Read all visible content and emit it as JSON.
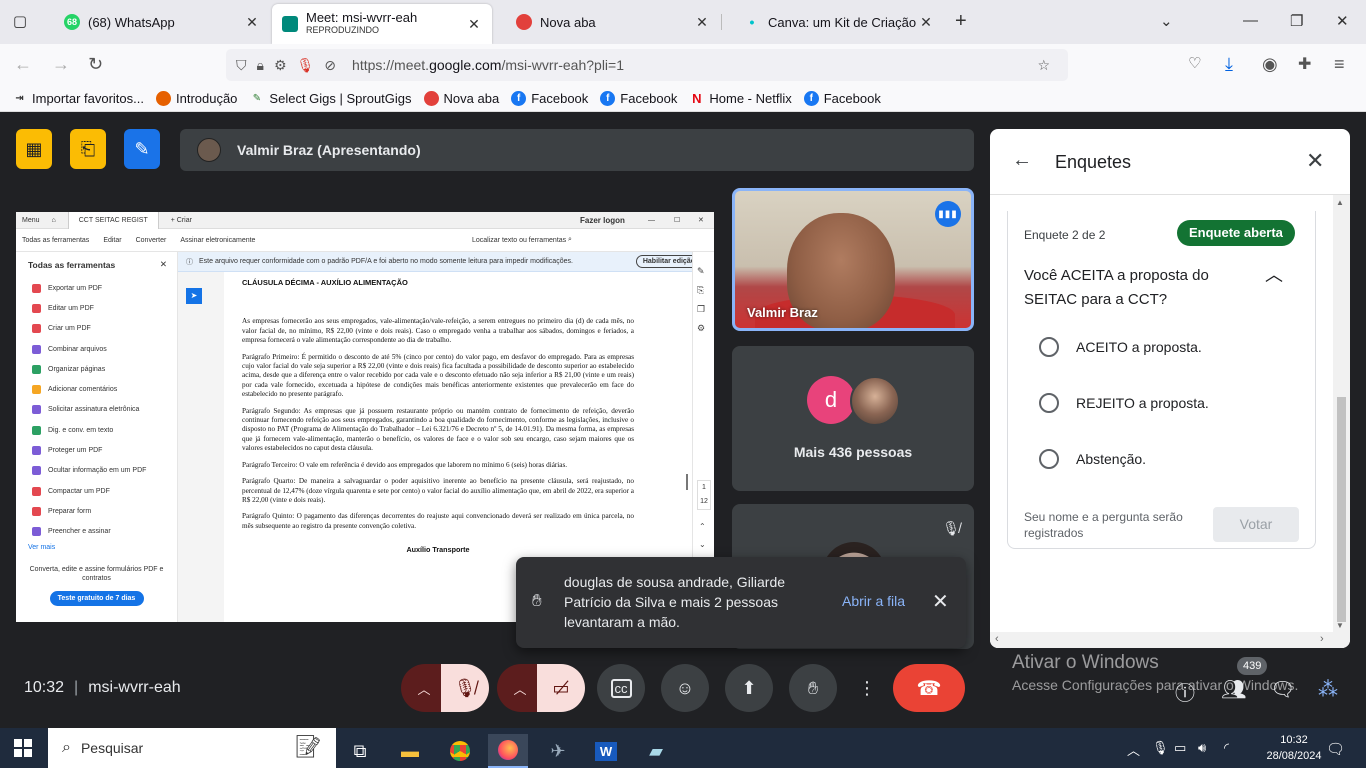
{
  "tabs": [
    {
      "title": "(68) WhatsApp",
      "badge": "68"
    },
    {
      "title": "Meet: msi-wvrr-eah",
      "subtitle": "REPRODUZINDO"
    },
    {
      "title": "Nova aba"
    },
    {
      "title": "Canva: um Kit de Criação Visual"
    }
  ],
  "url": {
    "prefix": "https://meet.",
    "domain": "google.com",
    "path": "/msi-wvrr-eah?pli=1"
  },
  "bookmarks": [
    "Importar favoritos...",
    "Introdução",
    "Select Gigs | SproutGigs",
    "Nova aba",
    "Facebook",
    "Facebook",
    "Home - Netflix",
    "Facebook"
  ],
  "presenter": {
    "label": "Valmir Braz (Apresentando)"
  },
  "share": {
    "top_menu": "Menu",
    "tab_title": "CCT SEITAC REGIST",
    "new_tab": "+ Criar",
    "login": "Fazer logon",
    "toolbar": [
      "Todas as ferramentas",
      "Editar",
      "Converter",
      "Assinar eletronicamente"
    ],
    "search_label": "Localizar texto ou ferramentas",
    "sidebar_title": "Todas as ferramentas",
    "sidebar_items": [
      "Exportar um PDF",
      "Editar um PDF",
      "Criar um PDF",
      "Combinar arquivos",
      "Organizar páginas",
      "Adicionar comentários",
      "Solicitar assinatura eletrônica",
      "Dig. e conv. em texto",
      "Proteger um PDF",
      "Ocultar informação em um PDF",
      "Compactar um PDF",
      "Preparar form",
      "Preencher e assinar"
    ],
    "see_more": "Ver mais",
    "note": "Converta, edite e assine formulários PDF e contratos",
    "trial": "Teste gratuito de 7 dias",
    "banner": "Este arquivo requer conformidade com o padrão PDF/A e foi aberto no modo somente leitura para impedir modificações.",
    "enable_edit": "Habilitar edição",
    "page_number": "1",
    "page_total": "12",
    "doc": {
      "heading": "CLÁUSULA DÉCIMA - AUXÍLIO ALIMENTAÇÃO",
      "p1": "As empresas fornecerão aos seus empregados, vale-alimentação/vale-refeição, a serem entregues no primeiro dia (d) de cada mês, no valor facial de, no mínimo, R$ 22,00 (vinte e dois reais). Caso o empregado venha a trabalhar aos sábados, domingos e feriados, a empresa fornecerá o vale alimentação correspondente ao dia de trabalho.",
      "p2": "Parágrafo Primeiro: É permitido o desconto de até 5% (cinco por cento) do valor pago, em desfavor do empregado. Para as empresas cujo valor facial do vale seja superior a R$ 22,00 (vinte e dois reais) fica facultada a possibilidade de desconto superior ao estabelecido acima, desde que a diferença entre o valor recebido por cada vale e o desconto efetuado não seja inferior a R$ 21,00 (vinte e um reais) por cada vale fornecido, excetuada a hipótese de condições mais benéficas anteriormente existentes que prevalecerão em face do estabelecido no presente parágrafo.",
      "p3": "Parágrafo Segundo: As empresas que já possuem restaurante próprio ou mantém contrato de fornecimento de refeição, deverão continuar fornecendo refeição aos seus empregados, garantindo a boa qualidade do fornecimento, conforme as legislações, inclusive o disposto no PAT (Programa de Alimentação do Trabalhador – Lei 6.321/76 e Decreto nº 5, de 14.01.91). Da mesma forma, as empresas que já fornecem vale-alimentação, manterão o benefício, os valores de face e o valor sob seu encargo, caso sejam maiores que os valores estabelecidos no caput desta cláusula.",
      "p4": "Parágrafo Terceiro: O vale em referência é devido aos empregados que laborem no mínimo 6 (seis) horas diárias.",
      "p5": "Parágrafo Quarto: De maneira a salvaguardar o poder aquisitivo inerente ao benefício na presente cláusula, será reajustado, no percentual de 12,47% (doze vírgula quarenta e sete por cento) o valor facial do auxílio alimentação que, em abril de 2022, era superior a R$ 22,00 (vinte e dois reais).",
      "p6": "Parágrafo Quinto: O pagamento das diferenças decorrentes do reajuste aqui convencionado deverá ser realizado em única parcela, no mês subsequente ao registro da presente convenção coletiva.",
      "next_heading": "Auxílio Transporte"
    }
  },
  "tiles": {
    "camera_name": "Valmir Braz",
    "avatar_letter": "d",
    "more_people": "Mais 436 pessoas"
  },
  "toast": {
    "text": "douglas de sousa andrade, Giliarde Patrício da Silva e mais 2 pessoas levantaram a mão.",
    "action": "Abrir a fila"
  },
  "panel": {
    "title": "Enquetes",
    "count": "Enquete 2 de 2",
    "status": "Enquete aberta",
    "question": "Você ACEITA a proposta do SEITAC para a CCT?",
    "options": [
      "ACEITO a proposta.",
      "REJEITO a proposta.",
      "Abstenção."
    ],
    "footer": "Seu nome e a pergunta serão registrados",
    "vote": "Votar"
  },
  "watermark": {
    "line1": "Ativar o Windows",
    "line2": "Acesse Configurações para ativar o Windows."
  },
  "meeting": {
    "time": "10:32",
    "code": "msi-wvrr-eah",
    "people_count": "439"
  },
  "taskbar": {
    "search": "Pesquisar",
    "time": "10:32",
    "date": "28/08/2024"
  },
  "colors": {
    "poll_status": "#137333",
    "end_call": "#ea4335",
    "speaking": "#8ab4f8",
    "muted_bg": "#f9dedc"
  }
}
